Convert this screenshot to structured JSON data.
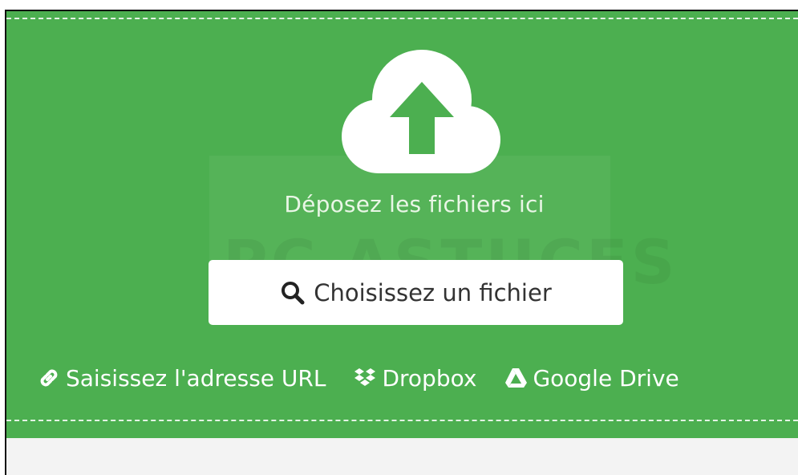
{
  "upload": {
    "drop_text": "Déposez les fichiers ici",
    "choose_label": "Choisissez un fichier",
    "watermark": "PC ASTUCES"
  },
  "sources": [
    {
      "label": "Saisissez l'adresse URL",
      "icon": "link-icon"
    },
    {
      "label": "Dropbox",
      "icon": "dropbox-icon"
    },
    {
      "label": "Google Drive",
      "icon": "google-drive-icon"
    }
  ],
  "colors": {
    "accent_green": "#4caf50",
    "text_white": "#ffffff",
    "button_bg": "#ffffff",
    "page_bg": "#f3f3f3"
  }
}
